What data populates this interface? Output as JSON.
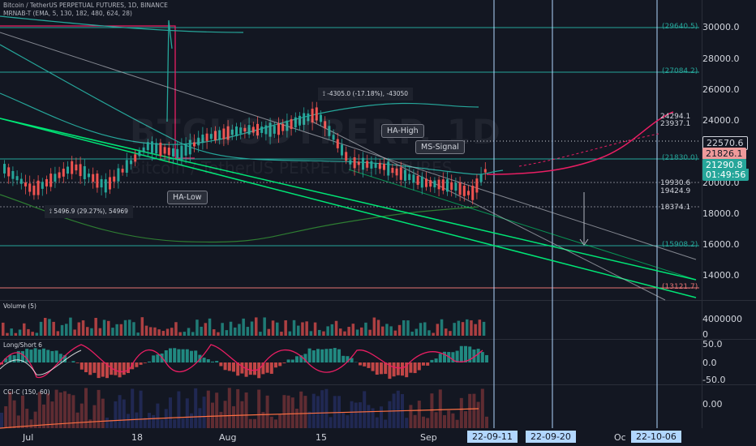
{
  "header": {
    "symbol_line": "Bitcoin / TetherUS PERPETUAL FUTURES, 1D, BINANCE",
    "indicator_line": "MRNAB-T (EMA, 5, 130, 182, 480, 624, 28)"
  },
  "watermark": {
    "ticker": "BTCUSDTPERP, 1D",
    "name": "Bitcoin / TetherUS PERPETUAL FUTURES"
  },
  "colors": {
    "background": "#131722",
    "up": "#26a69a",
    "down": "#ef5350",
    "accent_green": "#00e676",
    "accent_pink": "#e91e63",
    "trend_blue": "#b2b5be"
  },
  "price_axis": {
    "ticks": [
      "30000.0",
      "28000.0",
      "26000.0",
      "24000.0",
      "20000.0",
      "18000.0",
      "16000.0",
      "14000.0"
    ],
    "levels_right": [
      "(29640.5)",
      "(27084.2)",
      "24294.1",
      "23937.1",
      "(21830.0)",
      "19930.6",
      "19424.9",
      "18374.1",
      "(15908.2)",
      "(13121.7)"
    ],
    "badges": [
      {
        "text": "22570.6",
        "bg": "#131722",
        "fg": "#d1d4dc"
      },
      {
        "text": "21826.1",
        "bg": "#ef9a9a",
        "fg": "#131722"
      },
      {
        "text": "21290.8",
        "bg": "#26a69a",
        "fg": "#ffffff"
      },
      {
        "text": "01:49:56",
        "bg": "#26a69a",
        "fg": "#ffffff"
      }
    ]
  },
  "annotations": {
    "ha_high": "HA-High",
    "ha_low": "HA-Low",
    "ms_signal": "MS-Signal",
    "measure_top": "-4305.0 (-17.18%), -43050",
    "measure_bottom": "5496.9 (29.27%), 54969"
  },
  "panes": {
    "volume": {
      "title": "Volume (5)",
      "ticks": [
        "4000000",
        "0"
      ]
    },
    "longshort": {
      "title": "Long/Short 6",
      "ticks": [
        "50.0",
        "0.0",
        "-50.0"
      ]
    },
    "cci": {
      "title": "CCI-C (150, 60)",
      "ticks": [
        "0.00"
      ]
    }
  },
  "time_axis": {
    "ticks": [
      "Jul",
      "18",
      "Aug",
      "15",
      "Sep",
      "Oc"
    ],
    "date_tags": [
      "22-09-11",
      "22-09-20",
      "22-10-06"
    ]
  },
  "chart_data": {
    "type": "line",
    "title": "",
    "xlabel": "",
    "ylabel": "",
    "ylim": [
      12500,
      31000
    ],
    "x": [
      "Jul",
      "Jul 18",
      "Aug",
      "Aug 15",
      "Sep",
      "Oct"
    ],
    "series": [
      {
        "values": [
          20200,
          21500,
          23200,
          24300,
          20000,
          21290
        ]
      }
    ],
    "horizontal_levels": [
      29640.5,
      27084.2,
      24294.1,
      23937.1,
      22570.6,
      21826.1,
      21290.8,
      19930.6,
      19424.9,
      18374.1,
      15908.2,
      13121.7
    ],
    "grid": false,
    "legend": "none"
  }
}
